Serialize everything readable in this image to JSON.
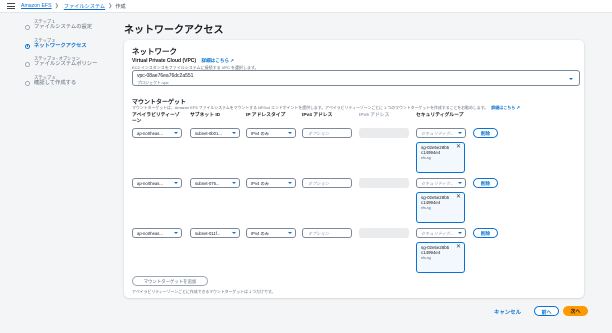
{
  "breadcrumb": {
    "root": "Amazon EFS",
    "parent": "ファイルシステム",
    "current": "作成"
  },
  "steps": [
    {
      "num": "ステップ 1",
      "title": "ファイルシステムの設定"
    },
    {
      "num": "ステップ 2",
      "title": "ネットワークアクセス"
    },
    {
      "num": "ステップ 3 - オプション",
      "title": "ファイルシステムポリシー"
    },
    {
      "num": "ステップ 4",
      "title": "確認して作成する"
    }
  ],
  "page_title": "ネットワークアクセス",
  "network": {
    "title": "ネットワーク",
    "vpc_label": "Virtual Private Cloud (VPC)",
    "info": "詳細はこちら",
    "vpc_desc": "EC2 インスタンスをファイルシステムに接続する VPC を選択します。",
    "vpc_value": "vpc-08ae76ea76dc2a551",
    "vpc_sub": "プロジェクト-vpc"
  },
  "mount": {
    "title": "マウントターゲット",
    "desc": "マウントターゲットは、Amazon EFS ファイルシステムをマウントする NFSv4 エンドポイントを提供します。アベイラビリティーゾーンごとに 1 つのマウントターゲットを作成することをお勧めします。",
    "info": "詳細はこちら",
    "headers": {
      "az": "アベイラビリティーゾ ーン",
      "subnet": "サブネット ID",
      "ip_type": "IP アドレスタイプ",
      "ipv4": "IPv4 アドレス",
      "ipv6": "IPv6 アドレス",
      "sg": "セキュリティグループ"
    },
    "rows": [
      {
        "az": "ap-northeas...",
        "subnet": "subnet-0b01...",
        "ip_type": "IPv4 のみ",
        "ipv4_placeholder": "オプション",
        "sg_placeholder": "セキュリティグ...",
        "remove": "削除",
        "sg_token": {
          "id": "sg-02e5e28b5c14994e4",
          "name": "efs-sg"
        }
      },
      {
        "az": "ap-northeas...",
        "subnet": "subnet-076...",
        "ip_type": "IPv4 のみ",
        "ipv4_placeholder": "オプション",
        "sg_placeholder": "セキュリティグ...",
        "remove": "削除",
        "sg_token": {
          "id": "sg-02e5e28b5c14994e4",
          "name": "efs-sg"
        }
      },
      {
        "az": "ap-northeas...",
        "subnet": "subnet-011f...",
        "ip_type": "IPv4 のみ",
        "ipv4_placeholder": "オプション",
        "sg_placeholder": "セキュリティグ...",
        "remove": "削除",
        "sg_token": {
          "id": "sg-02e5e28b5c14994e4",
          "name": "efs-sg"
        }
      }
    ],
    "add_button": "マウントターゲットを追加",
    "add_note": "アベイラビリティーゾーンごとに作成できるマウントターゲットは 1 つだけです。"
  },
  "footer": {
    "cancel": "キャンセル",
    "prev": "前へ",
    "next": "次へ"
  },
  "colors": {
    "accent": "#0972d3",
    "primary_button": "#ff9900"
  }
}
